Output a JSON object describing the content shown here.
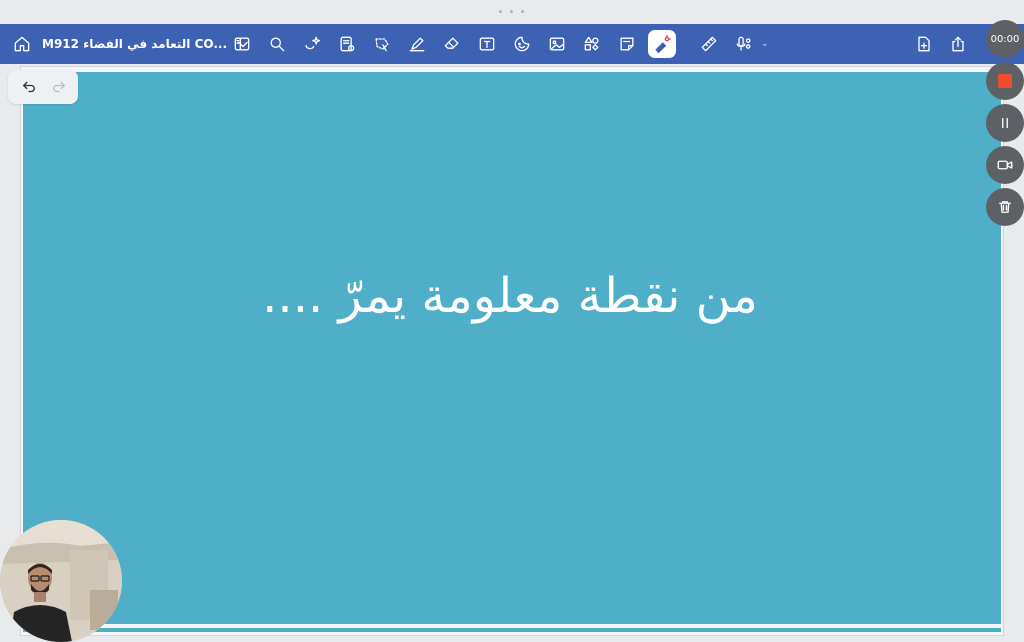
{
  "document": {
    "title": "M912 التعامد في الفضاء CO..."
  },
  "toolbar": {
    "icons": [
      "home-icon",
      "chevron-down-icon",
      "sidebar-icon",
      "search-icon",
      "lasso-sparkle-icon",
      "page-icon",
      "lasso-icon",
      "pen-icon",
      "eraser-icon",
      "text-box-icon",
      "sticker-icon",
      "image-icon",
      "shapes-icon",
      "sticky-note-icon",
      "laser-pointer-icon",
      "ruler-icon",
      "microphone-icon",
      "add-page-icon",
      "share-icon"
    ]
  },
  "slide": {
    "text": "من نقطة معلومة يمرّ ....",
    "background": "#4fafc9",
    "text_color": "#ffffff"
  },
  "recording": {
    "time": "00:00",
    "stop_color": "#f14b2f"
  },
  "colors": {
    "toolbar": "#3d61b3",
    "accent": "#f14b2f"
  }
}
